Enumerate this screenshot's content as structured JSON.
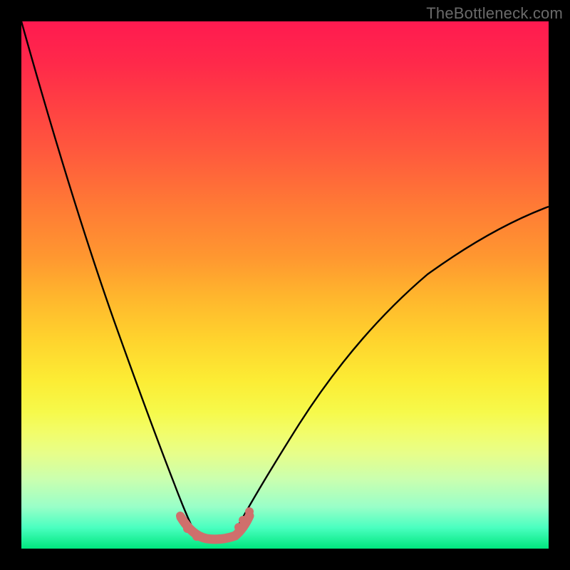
{
  "watermark": "TheBottleneck.com",
  "chart_data": {
    "type": "line",
    "title": "",
    "xlabel": "",
    "ylabel": "",
    "xlim": [
      0,
      1
    ],
    "ylim": [
      0,
      1
    ],
    "background_gradient": {
      "top": "#ff1a50",
      "mid": "#fcec34",
      "bottom": "#00e77e"
    },
    "series": [
      {
        "name": "left-curve",
        "x": [
          0.0,
          0.05,
          0.1,
          0.15,
          0.2,
          0.25,
          0.3,
          0.332
        ],
        "values": [
          1.0,
          0.8,
          0.6,
          0.42,
          0.26,
          0.14,
          0.06,
          0.02
        ]
      },
      {
        "name": "right-curve",
        "x": [
          0.4,
          0.45,
          0.5,
          0.55,
          0.6,
          0.65,
          0.7,
          0.75,
          0.8,
          0.85,
          0.9,
          0.95,
          1.0
        ],
        "values": [
          0.02,
          0.05,
          0.1,
          0.16,
          0.22,
          0.28,
          0.35,
          0.41,
          0.47,
          0.52,
          0.57,
          0.61,
          0.65
        ]
      },
      {
        "name": "bottom-flat",
        "x": [
          0.332,
          0.4
        ],
        "values": [
          0.02,
          0.02
        ]
      }
    ],
    "markers": {
      "name": "highlight-dots",
      "color": "#cf6f6c",
      "x": [
        0.302,
        0.315,
        0.332,
        0.352,
        0.375,
        0.395,
        0.412,
        0.42,
        0.432
      ],
      "values": [
        0.06,
        0.035,
        0.022,
        0.02,
        0.02,
        0.022,
        0.038,
        0.052,
        0.068
      ]
    },
    "bottom_band": {
      "name": "salmon-trough",
      "color": "#cf6f6c",
      "x_range": [
        0.302,
        0.432
      ],
      "y": 0.02
    }
  }
}
